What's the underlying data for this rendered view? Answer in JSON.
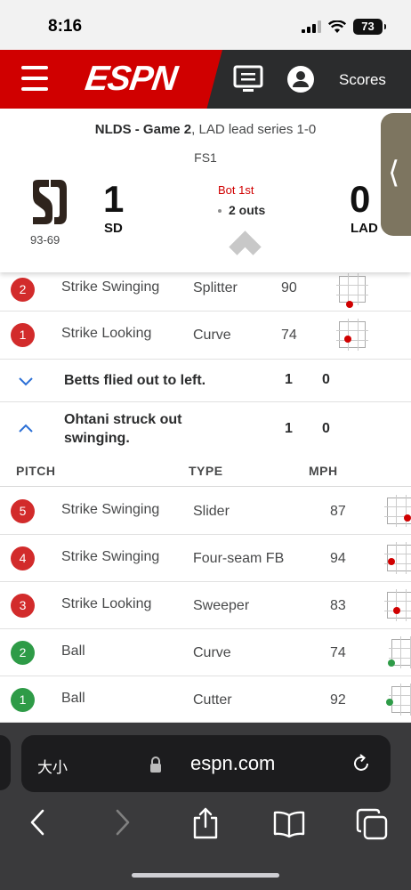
{
  "status": {
    "time": "8:16",
    "battery": "73"
  },
  "nav": {
    "logo": "ESPN",
    "scores_label": "Scores"
  },
  "scoreboard": {
    "series_game": "NLDS - Game 2",
    "series_status": ", LAD lead series 1-0",
    "network": "FS1",
    "away": {
      "abbr": "SD",
      "score": "1",
      "record": "93-69",
      "logo_text": "SD"
    },
    "home": {
      "abbr": "LAD",
      "score": "0"
    },
    "inning": "Bot 1st",
    "outs": "2 outs"
  },
  "prev_pitches": [
    {
      "num": "2",
      "result": "Strike Swinging",
      "type": "Splitter",
      "mph": "90",
      "color": "red"
    },
    {
      "num": "1",
      "result": "Strike Looking",
      "type": "Curve",
      "mph": "74",
      "color": "red"
    }
  ],
  "plays": [
    {
      "text": "Betts flied out to left.",
      "runs": "1",
      "outs": "0",
      "expanded": false
    },
    {
      "text_line1": "Ohtani struck out",
      "text_line2": "swinging.",
      "runs": "1",
      "outs": "0",
      "expanded": true
    }
  ],
  "columns": {
    "pitch": "PITCH",
    "type": "TYPE",
    "mph": "MPH"
  },
  "pitches": [
    {
      "num": "5",
      "result": "Strike Swinging",
      "type": "Slider",
      "mph": "87",
      "color": "red"
    },
    {
      "num": "4",
      "result": "Strike Swinging",
      "type": "Four-seam FB",
      "mph": "94",
      "color": "red"
    },
    {
      "num": "3",
      "result": "Strike Looking",
      "type": "Sweeper",
      "mph": "83",
      "color": "red"
    },
    {
      "num": "2",
      "result": "Ball",
      "type": "Curve",
      "mph": "74",
      "color": "green"
    },
    {
      "num": "1",
      "result": "Ball",
      "type": "Cutter",
      "mph": "92",
      "color": "green"
    }
  ],
  "safari": {
    "text_size": "大小",
    "url": "espn.com"
  },
  "colors": {
    "espn_red": "#d00000",
    "strike": "#d22b2b",
    "ball": "#2e9b47"
  }
}
